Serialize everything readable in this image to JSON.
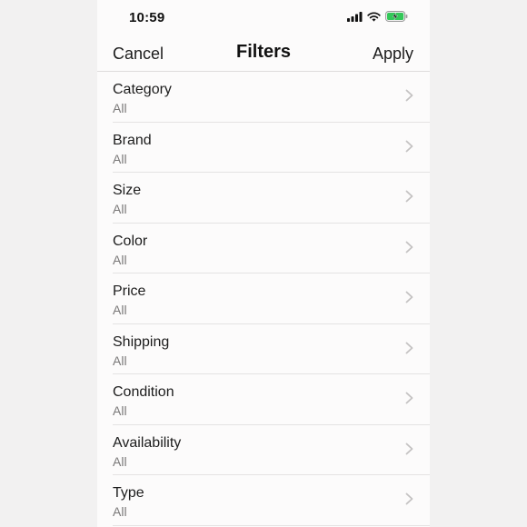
{
  "status_bar": {
    "time": "10:59",
    "icons": [
      "cellular-signal-icon",
      "wifi-icon",
      "battery-charging-icon"
    ]
  },
  "nav": {
    "cancel_label": "Cancel",
    "title": "Filters",
    "apply_label": "Apply"
  },
  "filters": [
    {
      "label": "Category",
      "value": "All"
    },
    {
      "label": "Brand",
      "value": "All"
    },
    {
      "label": "Size",
      "value": "All"
    },
    {
      "label": "Color",
      "value": "All"
    },
    {
      "label": "Price",
      "value": "All"
    },
    {
      "label": "Shipping",
      "value": "All"
    },
    {
      "label": "Condition",
      "value": "All"
    },
    {
      "label": "Availability",
      "value": "All"
    },
    {
      "label": "Type",
      "value": "All"
    }
  ],
  "colors": {
    "battery_fill": "#34c759",
    "chevron": "#c4c2c2"
  }
}
